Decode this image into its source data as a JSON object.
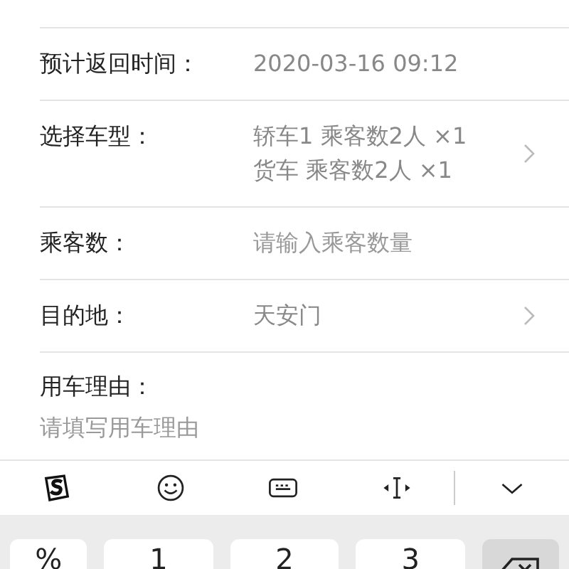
{
  "form": {
    "rows": [
      {
        "kind": "display",
        "label": "预计返回时间：",
        "values": [
          "2020-03-16 09:12"
        ],
        "has_arrow": false
      },
      {
        "kind": "display",
        "label": "选择车型：",
        "values": [
          "轿车1 乘客数2人 ×1",
          "货车 乘客数2人 ×1"
        ],
        "has_arrow": true
      },
      {
        "kind": "input",
        "label": "乘客数：",
        "placeholder": "请输入乘客数量"
      },
      {
        "kind": "display",
        "label": "目的地：",
        "values": [
          "天安门"
        ],
        "has_arrow": true
      },
      {
        "kind": "textarea",
        "label": "用车理由：",
        "placeholder": "请填写用车理由"
      }
    ]
  },
  "keyboard": {
    "toolbar": [
      {
        "kind": "logo"
      },
      {
        "kind": "emoji"
      },
      {
        "kind": "keyboard"
      },
      {
        "kind": "cursor"
      },
      {
        "kind": "divider"
      },
      {
        "kind": "collapse"
      }
    ],
    "keys": [
      {
        "kind": "char",
        "label": "%"
      },
      {
        "kind": "char",
        "label": "1"
      },
      {
        "kind": "char",
        "label": "2"
      },
      {
        "kind": "char",
        "label": "3"
      },
      {
        "kind": "backspace"
      }
    ]
  }
}
